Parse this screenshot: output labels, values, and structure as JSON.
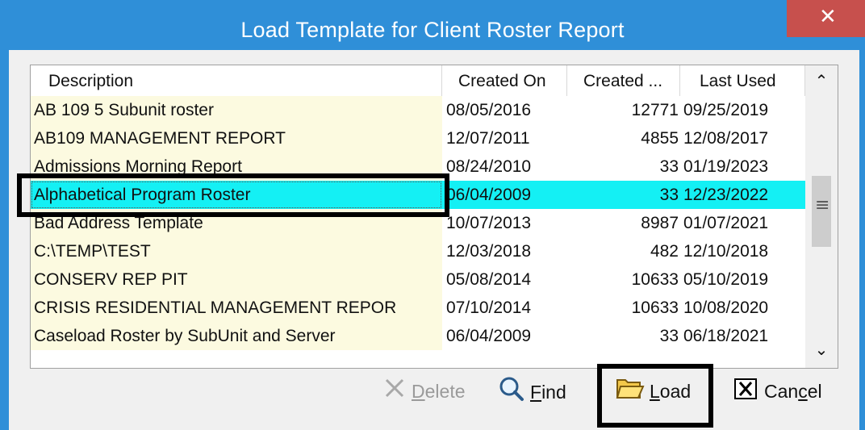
{
  "window": {
    "title": "Load Template for Client Roster Report"
  },
  "grid": {
    "headers": [
      "Description",
      "Created On",
      "Created ...",
      "Last Used"
    ],
    "rows": [
      {
        "description": "AB 109 5 Subunit roster",
        "created_on": "08/05/2016",
        "created_by": "12771",
        "last_used": "09/25/2019"
      },
      {
        "description": "AB109 MANAGEMENT REPORT",
        "created_on": "12/07/2011",
        "created_by": "4855",
        "last_used": "12/08/2017"
      },
      {
        "description": "Admissions Morning Report",
        "created_on": "08/24/2010",
        "created_by": "33",
        "last_used": "01/19/2023"
      },
      {
        "description": "Alphabetical Program Roster",
        "created_on": "06/04/2009",
        "created_by": "33",
        "last_used": "12/23/2022",
        "selected": true
      },
      {
        "description": "Bad Address Template",
        "created_on": "10/07/2013",
        "created_by": "8987",
        "last_used": "01/07/2021"
      },
      {
        "description": "C:\\TEMP\\TEST",
        "created_on": "12/03/2018",
        "created_by": "482",
        "last_used": "12/10/2018"
      },
      {
        "description": "CONSERV REP PIT",
        "created_on": "05/08/2014",
        "created_by": "10633",
        "last_used": "05/10/2019"
      },
      {
        "description": "CRISIS RESIDENTIAL MANAGEMENT REPOR",
        "created_on": "07/10/2014",
        "created_by": "10633",
        "last_used": "10/08/2020"
      },
      {
        "description": "Caseload Roster by SubUnit and Server",
        "created_on": "06/04/2009",
        "created_by": "33",
        "last_used": "06/18/2021"
      }
    ]
  },
  "buttons": {
    "delete": {
      "first": "D",
      "rest": "elete"
    },
    "find": {
      "first": "F",
      "rest": "ind"
    },
    "load": {
      "first": "L",
      "rest": "oad"
    },
    "cancel": {
      "pre": "Can",
      "ul": "c",
      "post": "el"
    }
  },
  "colors": {
    "titlebar": "#2f8fd8",
    "close": "#c7504d",
    "selection": "#14f0f4",
    "description_bg": "#fcfae0"
  }
}
